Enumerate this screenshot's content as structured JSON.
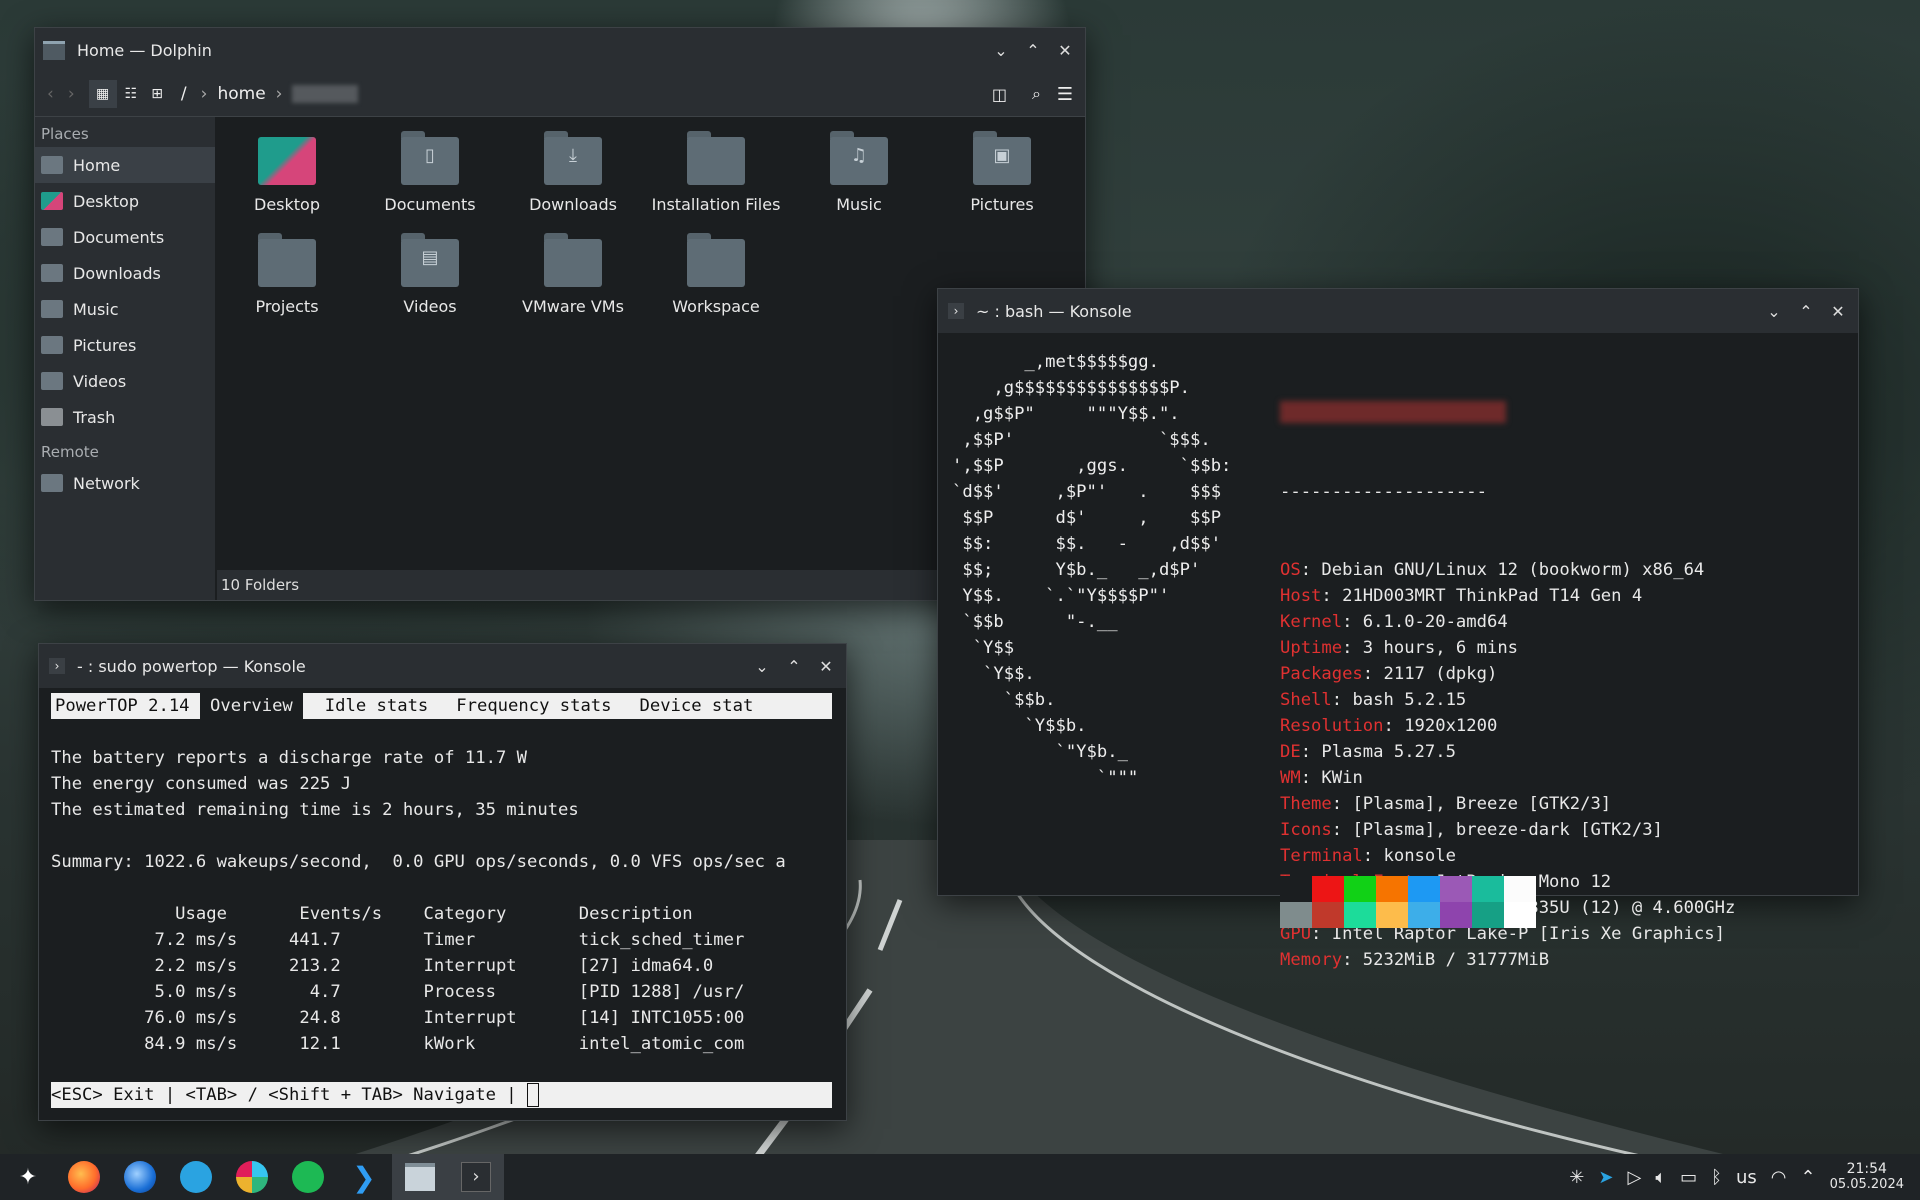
{
  "dolphin": {
    "title": "Home — Dolphin",
    "breadcrumb": [
      "/",
      "home"
    ],
    "places_header": "Places",
    "remote_header": "Remote",
    "places": [
      "Home",
      "Desktop",
      "Documents",
      "Downloads",
      "Music",
      "Pictures",
      "Videos",
      "Trash"
    ],
    "remote": [
      "Network"
    ],
    "folders": [
      "Desktop",
      "Documents",
      "Downloads",
      "Installation Files",
      "Music",
      "Pictures",
      "Projects",
      "Videos",
      "VMware VMs",
      "Workspace"
    ],
    "status": "10 Folders"
  },
  "konsole1": {
    "title": "~ : bash — Konsole",
    "ascii": "       _,met$$$$$gg.\n    ,g$$$$$$$$$$$$$$$P.\n  ,g$$P\"     \"\"\"Y$$.\".\n ,$$P'              `$$$.\n',$$P       ,ggs.     `$$b:\n`d$$'     ,$P\"'   .    $$$\n $$P      d$'     ,    $$P\n $$:      $$.   -    ,d$$'\n $$;      Y$b._   _,d$P'\n Y$$.    `.`\"Y$$$$P\"'\n `$$b      \"-.__\n  `Y$$\n   `Y$$.\n     `$$b.\n       `Y$$b.\n          `\"Y$b._\n              `\"\"\"",
    "separator": "--------------------",
    "info": [
      {
        "k": "OS",
        "v": "Debian GNU/Linux 12 (bookworm) x86_64"
      },
      {
        "k": "Host",
        "v": "21HD003MRT ThinkPad T14 Gen 4"
      },
      {
        "k": "Kernel",
        "v": "6.1.0-20-amd64"
      },
      {
        "k": "Uptime",
        "v": "3 hours, 6 mins"
      },
      {
        "k": "Packages",
        "v": "2117 (dpkg)"
      },
      {
        "k": "Shell",
        "v": "bash 5.2.15"
      },
      {
        "k": "Resolution",
        "v": "1920x1200"
      },
      {
        "k": "DE",
        "v": "Plasma 5.27.5"
      },
      {
        "k": "WM",
        "v": "KWin"
      },
      {
        "k": "Theme",
        "v": "[Plasma], Breeze [GTK2/3]"
      },
      {
        "k": "Icons",
        "v": "[Plasma], breeze-dark [GTK2/3]"
      },
      {
        "k": "Terminal",
        "v": "konsole"
      },
      {
        "k": "Terminal Font",
        "v": "JetBrains Mono 12"
      },
      {
        "k": "CPU",
        "v": "13th Gen Intel i5-1335U (12) @ 4.600GHz"
      },
      {
        "k": "GPU",
        "v": "Intel Raptor Lake-P [Iris Xe Graphics]"
      },
      {
        "k": "Memory",
        "v": "5232MiB / 31777MiB"
      }
    ],
    "palette_top": [
      "#1b1e20",
      "#ed1515",
      "#11d116",
      "#f67400",
      "#1d99f3",
      "#9b59b6",
      "#1abc9c",
      "#fcfcfc"
    ],
    "palette_bottom": [
      "#7f8c8d",
      "#c0392b",
      "#1cdc9a",
      "#fdbc4b",
      "#3daee9",
      "#8e44ad",
      "#16a085",
      "#ffffff"
    ]
  },
  "konsole2": {
    "title": "- : sudo powertop — Konsole",
    "tabs": [
      "PowerTOP 2.14",
      "Overview",
      "Idle stats",
      "Frequency stats",
      "Device stat"
    ],
    "lines": [
      "The battery reports a discharge rate of 11.7 W",
      "The energy consumed was 225 J",
      "The estimated remaining time is 2 hours, 35 minutes",
      "",
      "Summary: 1022.6 wakeups/second,  0.0 GPU ops/seconds, 0.0 VFS ops/sec a",
      "",
      "            Usage       Events/s    Category       Description",
      "          7.2 ms/s     441.7        Timer          tick_sched_timer",
      "          2.2 ms/s     213.2        Interrupt      [27] idma64.0",
      "          5.0 ms/s       4.7        Process        [PID 1288] /usr/",
      "         76.0 ms/s      24.8        Interrupt      [14] INTC1055:00",
      "         84.9 ms/s      12.1        kWork          intel_atomic_com"
    ],
    "footer": "<ESC> Exit | <TAB> / <Shift + TAB> Navigate | "
  },
  "taskbar": {
    "apps": [
      "launcher-icon",
      "firefox-icon",
      "thunderbird-icon",
      "telegram-icon",
      "slack-icon",
      "spotify-icon",
      "vscode-icon",
      "dolphin-icon",
      "konsole-icon"
    ],
    "layout": "us",
    "time": "21:54",
    "date": "05.05.2024"
  }
}
